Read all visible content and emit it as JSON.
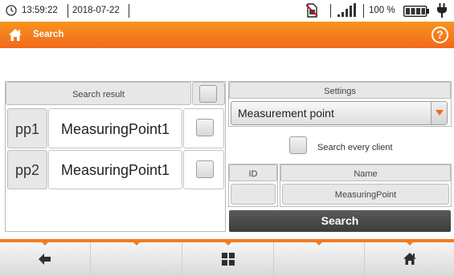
{
  "status_bar": {
    "time": "13:59:22",
    "date": "2018-07-22",
    "battery_percent": "100 %",
    "icons": [
      "clock-icon",
      "no-sim-icon",
      "signal-icon",
      "battery-icon",
      "power-plug-icon"
    ]
  },
  "title_bar": {
    "title": "Search",
    "icons": [
      "home-icon",
      "help-icon"
    ],
    "help_glyph": "?"
  },
  "results": {
    "header": "Search result",
    "rows": [
      {
        "id": "pp1",
        "name": "MeasuringPoint1"
      },
      {
        "id": "pp2",
        "name": "MeasuringPoint1"
      }
    ]
  },
  "settings": {
    "header": "Settings",
    "selected": "Measurement point",
    "search_every_client_label": "Search every client",
    "id_label": "ID",
    "id_value": "",
    "name_label": "Name",
    "name_value": "MeasuringPoint",
    "search_button": "Search"
  },
  "bottom_bar": {
    "icons": [
      "back-arrow-icon",
      "grid-menu-icon",
      "home-icon"
    ]
  },
  "colors": {
    "accent": "#f47b20",
    "title_gradient_top": "#f7931e",
    "title_gradient_bottom": "#f26a1b",
    "dark_button": "#484848"
  }
}
